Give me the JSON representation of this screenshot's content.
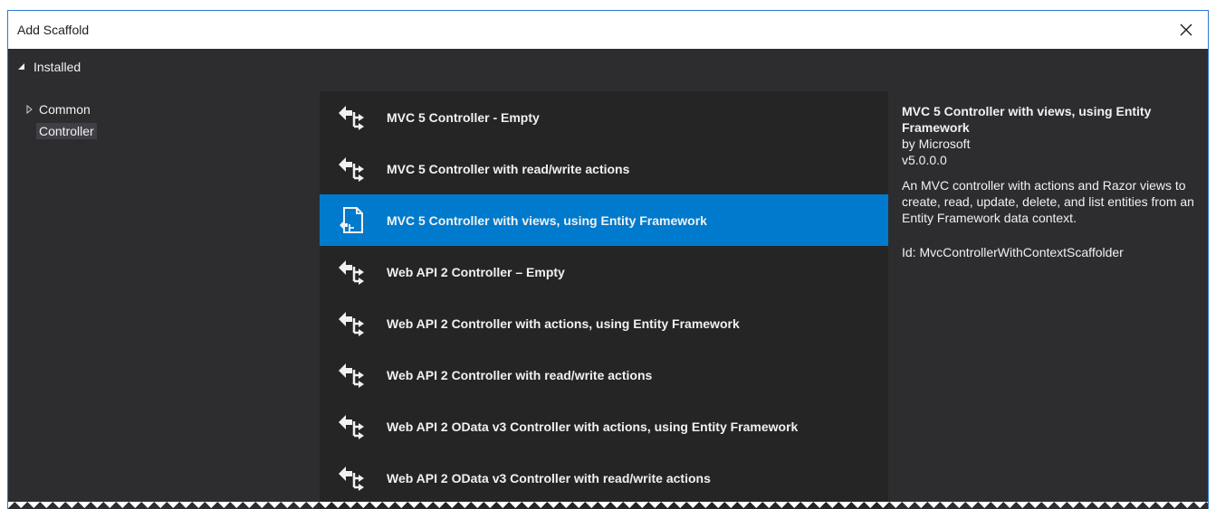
{
  "window": {
    "title": "Add Scaffold"
  },
  "tree": {
    "root": "Installed",
    "items": [
      {
        "label": "Common",
        "expandable": true
      },
      {
        "label": "Controller",
        "selected": true
      }
    ]
  },
  "scaffolders": [
    {
      "label": "MVC 5 Controller - Empty",
      "icon": "controller-icon"
    },
    {
      "label": "MVC 5 Controller with read/write actions",
      "icon": "controller-icon"
    },
    {
      "label": "MVC 5 Controller with views, using Entity Framework",
      "icon": "views-controller-icon",
      "selected": true
    },
    {
      "label": "Web API 2 Controller – Empty",
      "icon": "controller-icon"
    },
    {
      "label": "Web API 2 Controller with actions, using Entity Framework",
      "icon": "controller-icon"
    },
    {
      "label": "Web API 2 Controller with read/write actions",
      "icon": "controller-icon"
    },
    {
      "label": "Web API 2 OData v3 Controller with actions, using Entity Framework",
      "icon": "controller-icon"
    },
    {
      "label": "Web API 2 OData v3 Controller with read/write actions",
      "icon": "controller-icon"
    }
  ],
  "details": {
    "name": "MVC 5 Controller with views, using Entity Framework",
    "author": "by Microsoft",
    "version": "v5.0.0.0",
    "description": "An MVC controller with actions and Razor views to create, read, update, delete, and list entities from an Entity Framework data context.",
    "id": "Id: MvcControllerWithContextScaffolder"
  },
  "colors": {
    "selection": "#007acc",
    "background": "#2d2d30",
    "list_background": "#252526",
    "tree_selection": "#3f3f46"
  }
}
